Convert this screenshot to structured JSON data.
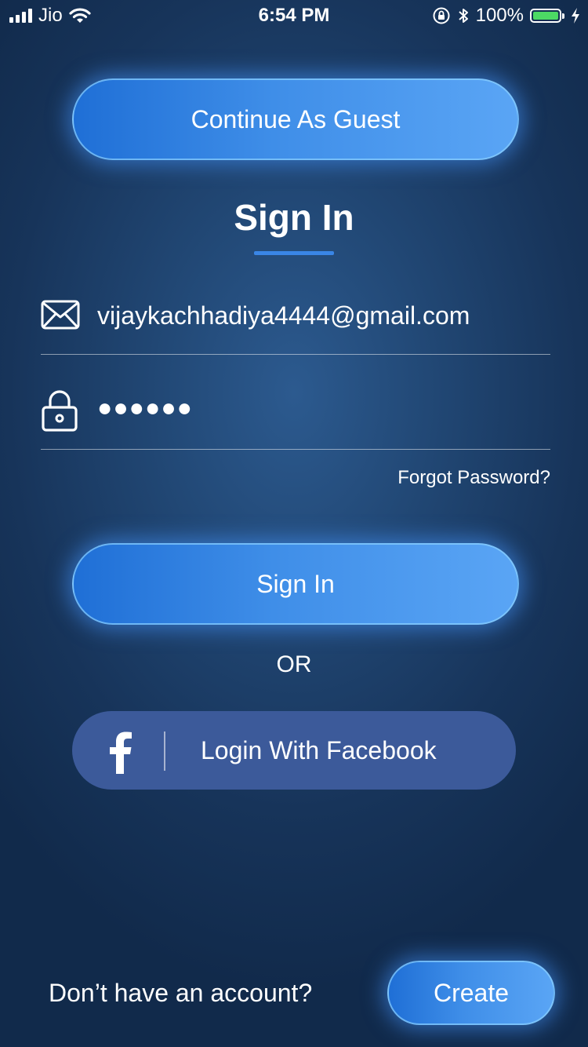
{
  "status_bar": {
    "carrier": "Jio",
    "time": "6:54 PM",
    "battery_percent": "100%",
    "battery_level": 1.0,
    "icons": [
      "signal-icon",
      "wifi-icon",
      "rotation-lock-icon",
      "bluetooth-icon",
      "battery-icon",
      "charging-icon"
    ]
  },
  "guest_button_label": "Continue As Guest",
  "title": "Sign In",
  "email_field": {
    "icon": "mail-icon",
    "value": "vijaykachhadiya4444@gmail.com"
  },
  "password_field": {
    "icon": "lock-icon",
    "value": "●●●●●●"
  },
  "forgot_password_label": "Forgot Password?",
  "signin_button_label": "Sign In",
  "or_label": "OR",
  "facebook_button": {
    "icon": "facebook-icon",
    "label": "Login With Facebook",
    "color": "#3c5a9a"
  },
  "footer": {
    "prompt": "Don’t have an account?",
    "create_button_label": "Create"
  },
  "colors": {
    "accent": "#3a86e6",
    "button_gradient_start": "#1f6fd6",
    "button_gradient_end": "#5aa5f5",
    "background": "#1b3d66",
    "battery": "#4cd964"
  }
}
